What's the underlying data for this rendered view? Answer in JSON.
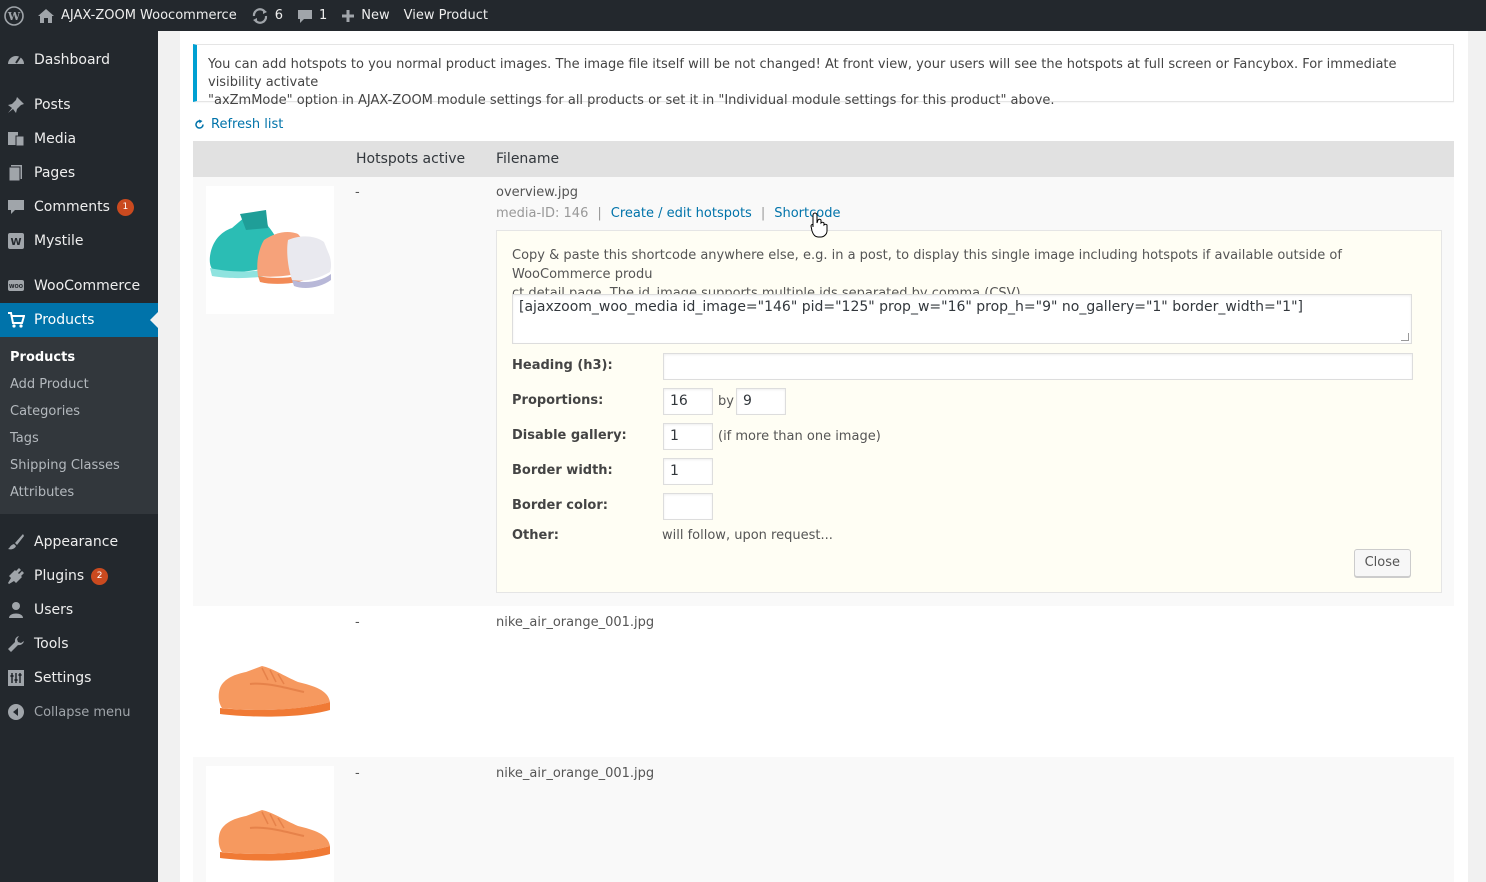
{
  "adminbar": {
    "site_name": "AJAX-ZOOM Woocommerce",
    "updates_count": "6",
    "comments_count": "1",
    "new_label": "New",
    "view_product_label": "View Product"
  },
  "sidebar": {
    "items": [
      {
        "label": "Dashboard",
        "icon": "dashboard-icon"
      },
      {
        "label": "Posts",
        "icon": "pin-icon"
      },
      {
        "label": "Media",
        "icon": "media-icon"
      },
      {
        "label": "Pages",
        "icon": "pages-icon"
      },
      {
        "label": "Comments",
        "icon": "comment-icon",
        "badge": "1"
      },
      {
        "label": "Mystile",
        "icon": "theme-icon"
      },
      {
        "label": "WooCommerce",
        "icon": "woo-icon"
      },
      {
        "label": "Products",
        "icon": "cart-icon"
      },
      {
        "label": "Appearance",
        "icon": "brush-icon"
      },
      {
        "label": "Plugins",
        "icon": "plug-icon",
        "badge": "2"
      },
      {
        "label": "Users",
        "icon": "user-icon"
      },
      {
        "label": "Tools",
        "icon": "wrench-icon"
      },
      {
        "label": "Settings",
        "icon": "settings-icon"
      }
    ],
    "submenu": [
      "Products",
      "Add Product",
      "Categories",
      "Tags",
      "Shipping Classes",
      "Attributes"
    ],
    "collapse_label": "Collapse menu"
  },
  "notice": {
    "text_line1": "You can add hotspots to you normal product images. The image file itself will be not changed! At front view, your users will see the hotspots at full screen or Fancybox. For immediate visibility activate",
    "text_line2": "\"axZmMode\" option in AJAX-ZOOM module settings for all products or set it in \"Individual module settings for this product\" above."
  },
  "refresh_label": "Refresh list",
  "table": {
    "col_hotspots": "Hotspots active",
    "col_filename": "Filename",
    "rows": [
      {
        "hotspots": "-",
        "filename": "overview.jpg",
        "media_id": "media-ID: 146",
        "edit_link": "Create / edit hotspots",
        "shortcode_link": "Shortcode"
      },
      {
        "hotspots": "-",
        "filename": "nike_air_orange_001.jpg"
      },
      {
        "hotspots": "-",
        "filename": "nike_air_orange_001.jpg"
      }
    ]
  },
  "shortcode_panel": {
    "desc_line1": "Copy & paste this shortcode anywhere else, e.g. in a post, to display this single image including hotspots if available outside of WooCommerce produ",
    "desc_line2": "ct detail page. The id_image supports multiple ids separated by comma (CSV).",
    "shortcode": "[ajaxzoom_woo_media id_image=\"146\" pid=\"125\" prop_w=\"16\" prop_h=\"9\" no_gallery=\"1\" border_width=\"1\"]",
    "heading_label": "Heading (h3):",
    "heading_value": "",
    "proportions_label": "Proportions:",
    "prop_w": "16",
    "by_label": "by",
    "prop_h": "9",
    "gallery_label": "Disable gallery:",
    "gallery_value": "1",
    "gallery_hint": "(if more than one image)",
    "border_width_label": "Border width:",
    "border_width_value": "1",
    "border_color_label": "Border color:",
    "border_color_value": "",
    "other_label": "Other:",
    "other_text": "will follow, upon request...",
    "close_label": "Close"
  },
  "colors": {
    "admin_dark": "#23282d",
    "accent_blue": "#0073aa",
    "notice_border": "#00a0d2",
    "badge_orange": "#ca4a1f"
  }
}
